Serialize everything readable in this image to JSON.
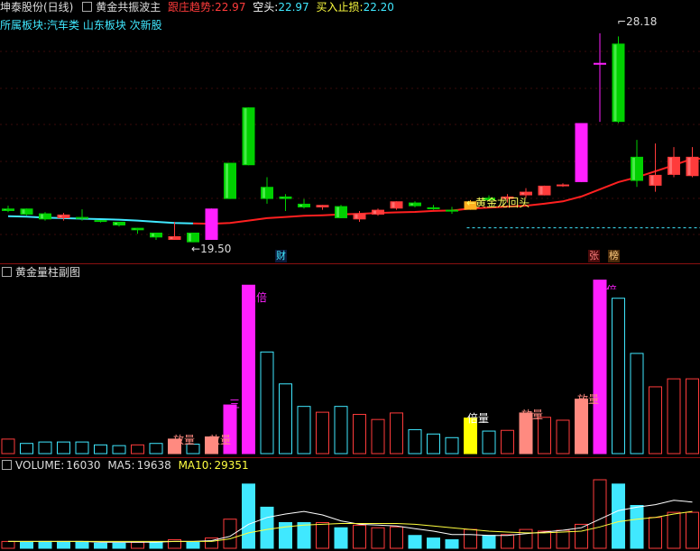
{
  "colors": {
    "up": "#ff3b3b",
    "down": "#00d000",
    "magenta": "#ff20ff",
    "cyan": "#40e8ff",
    "yellow": "#ffff00",
    "salmon": "#ff8a80",
    "white": "#ffffff",
    "ma5": "#ffffff",
    "ma10": "#ffff40",
    "red_line": "#ff2020"
  },
  "header": {
    "stock_title": "坤泰股份(日线)",
    "indicator_name": "黄金共振波主",
    "trend_label": "跟庄趋势:",
    "trend_value": "22.97",
    "short_label": "空头:",
    "short_value": "22.97",
    "stop_label": "买入止损:",
    "stop_value": "22.20",
    "sector_label": "所属板块:",
    "sectors": "汽车类 山东板块 次新股"
  },
  "main_chart": {
    "high_label": "28.18",
    "low_label": "19.50",
    "callout": "黄金龙回头",
    "markers": {
      "cai": "财",
      "zhang": "张",
      "bang": "榜"
    },
    "candles": [
      {
        "o": 20.9,
        "h": 21.02,
        "l": 20.75,
        "c": 20.8
      },
      {
        "o": 20.9,
        "h": 20.9,
        "l": 20.62,
        "c": 20.65
      },
      {
        "o": 20.7,
        "h": 20.75,
        "l": 20.4,
        "c": 20.45
      },
      {
        "o": 20.5,
        "h": 20.72,
        "l": 20.4,
        "c": 20.65
      },
      {
        "o": 20.55,
        "h": 20.87,
        "l": 20.4,
        "c": 20.48
      },
      {
        "o": 20.42,
        "h": 20.42,
        "l": 20.32,
        "c": 20.35
      },
      {
        "o": 20.35,
        "h": 20.35,
        "l": 20.15,
        "c": 20.2
      },
      {
        "o": 20.1,
        "h": 20.1,
        "l": 19.85,
        "c": 20.0
      },
      {
        "o": 19.9,
        "h": 19.9,
        "l": 19.6,
        "c": 19.7
      },
      {
        "o": 19.6,
        "h": 20.35,
        "l": 19.6,
        "c": 19.75
      },
      {
        "o": 19.9,
        "h": 19.9,
        "l": 19.5,
        "c": 19.5
      },
      {
        "o": 19.6,
        "h": 20.9,
        "l": 19.6,
        "c": 20.9,
        "type": "mag"
      },
      {
        "o": 22.8,
        "h": 22.8,
        "l": 21.3,
        "c": 21.3
      },
      {
        "o": 25.1,
        "h": 25.1,
        "l": 22.7,
        "c": 22.7
      },
      {
        "o": 21.8,
        "h": 22.2,
        "l": 21.1,
        "c": 21.3
      },
      {
        "o": 21.4,
        "h": 21.5,
        "l": 20.8,
        "c": 21.3
      },
      {
        "o": 21.1,
        "h": 21.3,
        "l": 20.9,
        "c": 20.95
      },
      {
        "o": 20.95,
        "h": 21.05,
        "l": 20.85,
        "c": 21.05
      },
      {
        "o": 21.0,
        "h": 21.05,
        "l": 20.5,
        "c": 20.5
      },
      {
        "o": 20.45,
        "h": 20.8,
        "l": 20.35,
        "c": 20.7
      },
      {
        "o": 20.65,
        "h": 20.9,
        "l": 20.6,
        "c": 20.85
      },
      {
        "o": 20.9,
        "h": 21.2,
        "l": 20.85,
        "c": 21.2
      },
      {
        "o": 21.15,
        "h": 21.2,
        "l": 20.95,
        "c": 21.0
      },
      {
        "o": 20.95,
        "h": 21.05,
        "l": 20.85,
        "c": 20.9
      },
      {
        "o": 20.85,
        "h": 20.97,
        "l": 20.68,
        "c": 20.78
      },
      {
        "o": 20.85,
        "h": 21.25,
        "l": 20.85,
        "c": 21.2,
        "type": "gold"
      },
      {
        "o": 21.35,
        "h": 21.45,
        "l": 21.2,
        "c": 21.25
      },
      {
        "o": 21.3,
        "h": 21.5,
        "l": 21.15,
        "c": 21.4
      },
      {
        "o": 21.45,
        "h": 21.75,
        "l": 21.35,
        "c": 21.6
      },
      {
        "o": 21.45,
        "h": 21.85,
        "l": 21.45,
        "c": 21.85
      },
      {
        "o": 21.9,
        "h": 21.95,
        "l": 21.8,
        "c": 21.9
      },
      {
        "o": 22.0,
        "h": 24.45,
        "l": 22.0,
        "c": 24.45,
        "type": "mag"
      },
      {
        "o": 26.95,
        "h": 28.18,
        "l": 24.5,
        "c": 26.95,
        "type": "mag"
      },
      {
        "o": 27.75,
        "h": 28.05,
        "l": 24.45,
        "c": 24.5
      },
      {
        "o": 23.05,
        "h": 23.75,
        "l": 21.8,
        "c": 22.05
      },
      {
        "o": 21.85,
        "h": 23.6,
        "l": 21.6,
        "c": 22.3
      },
      {
        "o": 22.3,
        "h": 23.45,
        "l": 22.2,
        "c": 23.05
      },
      {
        "o": 22.25,
        "h": 23.45,
        "l": 22.2,
        "c": 23.05
      }
    ],
    "trend_line": [
      20.58,
      20.56,
      20.52,
      20.5,
      20.48,
      20.46,
      20.44,
      20.4,
      20.35,
      20.3,
      20.28,
      20.27,
      20.3,
      20.4,
      20.5,
      20.55,
      20.6,
      20.62,
      20.66,
      20.68,
      20.72,
      20.74,
      20.76,
      20.8,
      20.82,
      20.9,
      20.94,
      20.98,
      21.02,
      21.1,
      21.2,
      21.4,
      21.7,
      22.0,
      22.2,
      22.45,
      22.7,
      22.97
    ],
    "trend_cyan_until": 10,
    "stop_line_from": 25
  },
  "sub_chart": {
    "title": "黄金量柱副图",
    "labels": {
      "sanbei": "三倍",
      "fangliang": "放量",
      "beiliang": "倍量",
      "san": "三"
    },
    "bars": [
      {
        "v": 2,
        "k": "up"
      },
      {
        "v": 1.4,
        "k": "down"
      },
      {
        "v": 1.6,
        "k": "down"
      },
      {
        "v": 1.6,
        "k": "down"
      },
      {
        "v": 1.6,
        "k": "down"
      },
      {
        "v": 1.2,
        "k": "down"
      },
      {
        "v": 1.1,
        "k": "down"
      },
      {
        "v": 1.2,
        "k": "up"
      },
      {
        "v": 1.4,
        "k": "down"
      },
      {
        "v": 2.0,
        "k": "salmon"
      },
      {
        "v": 1.3,
        "k": "down"
      },
      {
        "v": 2.3,
        "k": "salmon"
      },
      {
        "v": 6.7,
        "k": "mag"
      },
      {
        "v": 23.2,
        "k": "mag"
      },
      {
        "v": 14.0,
        "k": "down"
      },
      {
        "v": 9.6,
        "k": "down"
      },
      {
        "v": 6.5,
        "k": "down"
      },
      {
        "v": 5.7,
        "k": "up"
      },
      {
        "v": 6.5,
        "k": "down"
      },
      {
        "v": 5.4,
        "k": "up"
      },
      {
        "v": 4.7,
        "k": "up"
      },
      {
        "v": 5.6,
        "k": "up"
      },
      {
        "v": 3.3,
        "k": "down"
      },
      {
        "v": 2.7,
        "k": "down"
      },
      {
        "v": 2.2,
        "k": "down"
      },
      {
        "v": 4.9,
        "k": "yellow"
      },
      {
        "v": 3.1,
        "k": "down"
      },
      {
        "v": 3.2,
        "k": "up"
      },
      {
        "v": 5.6,
        "k": "salmon"
      },
      {
        "v": 5.0,
        "k": "up"
      },
      {
        "v": 4.6,
        "k": "up"
      },
      {
        "v": 7.5,
        "k": "salmon"
      },
      {
        "v": 23.9,
        "k": "mag"
      },
      {
        "v": 21.4,
        "k": "down"
      },
      {
        "v": 13.8,
        "k": "down"
      },
      {
        "v": 9.2,
        "k": "up"
      },
      {
        "v": 10.3,
        "k": "up"
      },
      {
        "v": 10.3,
        "k": "up"
      }
    ]
  },
  "volume": {
    "label_volume": "VOLUME:",
    "value_volume": "16030",
    "label_ma5": "MA5:",
    "value_ma5": "19638",
    "label_ma10": "MA10:",
    "value_ma10": "29351",
    "bars": [
      {
        "v": 8,
        "k": "up"
      },
      {
        "v": 7,
        "k": "down"
      },
      {
        "v": 8,
        "k": "down"
      },
      {
        "v": 8,
        "k": "down"
      },
      {
        "v": 8,
        "k": "down"
      },
      {
        "v": 6,
        "k": "down"
      },
      {
        "v": 6,
        "k": "down"
      },
      {
        "v": 7,
        "k": "up"
      },
      {
        "v": 7,
        "k": "down"
      },
      {
        "v": 10,
        "k": "up"
      },
      {
        "v": 7,
        "k": "down"
      },
      {
        "v": 12,
        "k": "up"
      },
      {
        "v": 34,
        "k": "up"
      },
      {
        "v": 75,
        "k": "down"
      },
      {
        "v": 48,
        "k": "down"
      },
      {
        "v": 30,
        "k": "down"
      },
      {
        "v": 30,
        "k": "down"
      },
      {
        "v": 30,
        "k": "up"
      },
      {
        "v": 24,
        "k": "down"
      },
      {
        "v": 27,
        "k": "up"
      },
      {
        "v": 24,
        "k": "up"
      },
      {
        "v": 25,
        "k": "up"
      },
      {
        "v": 15,
        "k": "down"
      },
      {
        "v": 12,
        "k": "down"
      },
      {
        "v": 10,
        "k": "down"
      },
      {
        "v": 22,
        "k": "up"
      },
      {
        "v": 15,
        "k": "down"
      },
      {
        "v": 16,
        "k": "up"
      },
      {
        "v": 22,
        "k": "up"
      },
      {
        "v": 20,
        "k": "up"
      },
      {
        "v": 21,
        "k": "up"
      },
      {
        "v": 28,
        "k": "up"
      },
      {
        "v": 80,
        "k": "up"
      },
      {
        "v": 75,
        "k": "down"
      },
      {
        "v": 50,
        "k": "down"
      },
      {
        "v": 36,
        "k": "up"
      },
      {
        "v": 42,
        "k": "up"
      },
      {
        "v": 42,
        "k": "up"
      }
    ],
    "ma5": [
      8,
      8,
      8,
      8,
      8,
      7,
      7,
      7,
      7,
      8,
      8,
      9,
      14,
      28,
      36,
      40,
      43,
      39,
      32,
      28,
      27,
      26,
      23,
      20,
      16,
      16,
      15,
      15,
      17,
      19,
      21,
      24,
      34,
      44,
      48,
      51,
      56,
      54
    ],
    "ma10": [
      8,
      8,
      8,
      8,
      8,
      8,
      8,
      8,
      8,
      8,
      8,
      8,
      11,
      18,
      22,
      25,
      27,
      28,
      29,
      29,
      29,
      29,
      28,
      26,
      24,
      22,
      20,
      19,
      18,
      18,
      19,
      20,
      25,
      31,
      34,
      36,
      40,
      43
    ]
  }
}
